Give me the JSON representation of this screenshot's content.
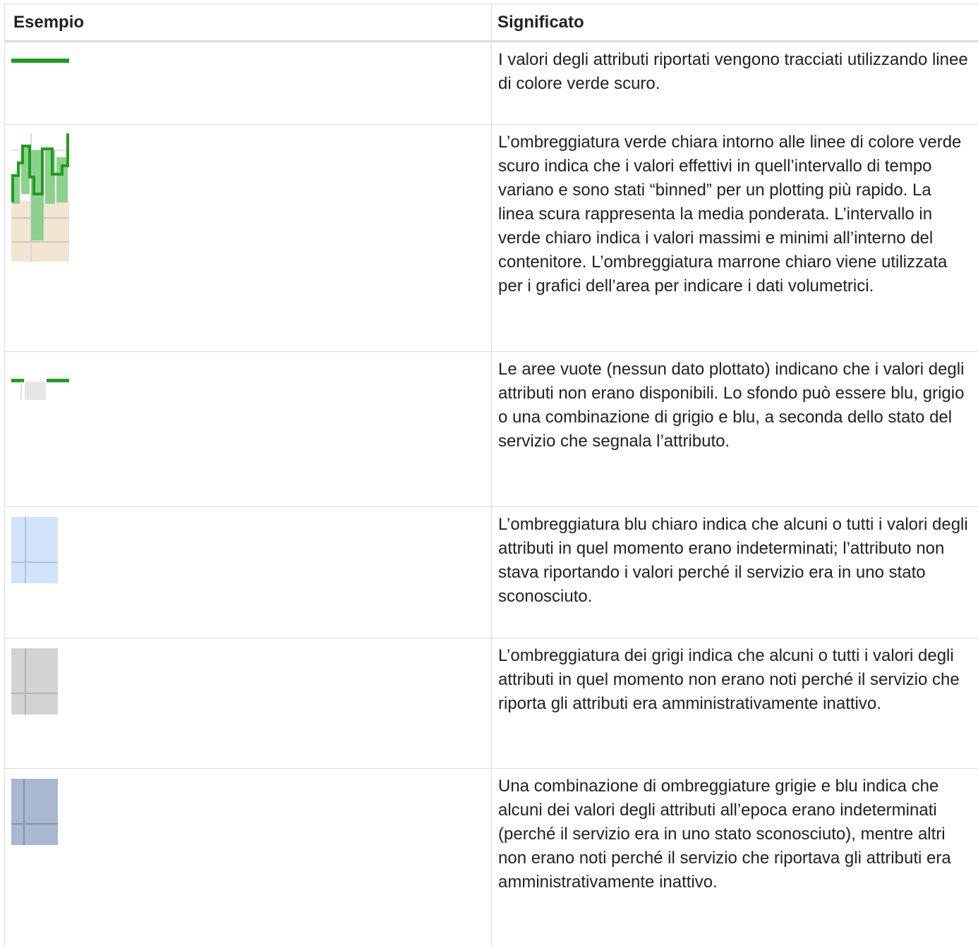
{
  "table": {
    "headers": {
      "example": "Esempio",
      "meaning": "Significato"
    },
    "rows": [
      {
        "example_icon": "dark-green-line",
        "meaning": "I valori degli attributi riportati vengono tracciati utilizzando linee di colore verde scuro."
      },
      {
        "example_icon": "binned-green-shading-chart",
        "meaning": "L’ombreggiatura verde chiara intorno alle linee di colore verde scuro indica che i valori effettivi in quell’intervallo di tempo variano e sono stati “binned” per un plotting più rapido. La linea scura rappresenta la media ponderata. L’intervallo in verde chiaro indica i valori massimi e minimi all’interno del contenitore. L’ombreggiatura marrone chiaro viene utilizzata per i grafici dell’area per indicare i dati volumetrici."
      },
      {
        "example_icon": "gap-in-line",
        "meaning": "Le aree vuote (nessun dato plottato) indicano che i valori degli attributi non erano disponibili. Lo sfondo può essere blu, grigio o una combinazione di grigio e blu, a seconda dello stato del servizio che segnala l’attributo."
      },
      {
        "example_icon": "light-blue-swatch",
        "meaning": "L’ombreggiatura blu chiaro indica che alcuni o tutti i valori degli attributi in quel momento erano indeterminati; l’attributo non stava riportando i valori perché il servizio era in uno stato sconosciuto."
      },
      {
        "example_icon": "gray-swatch",
        "meaning": "L’ombreggiatura dei grigi indica che alcuni o tutti i valori degli attributi in quel momento non erano noti perché il servizio che riporta gli attributi era amministrativamente inattivo."
      },
      {
        "example_icon": "gray-blue-swatch",
        "meaning": "Una combinazione di ombreggiature grigie e blu indica che alcuni dei valori degli attributi all’epoca erano indeterminati (perché il servizio era in uno stato sconosciuto), mentre altri non erano noti perché il servizio che riportava gli attributi era amministrativamente inattivo."
      }
    ]
  },
  "colors": {
    "dark_green": "#1e9e1e",
    "light_green": "#8ed08e",
    "tan": "#f2e6d3",
    "light_blue": "#d2e3fb",
    "gray": "#d3d3d3",
    "gray_blue": "#a9b7cf",
    "border": "#dcdcdc"
  }
}
